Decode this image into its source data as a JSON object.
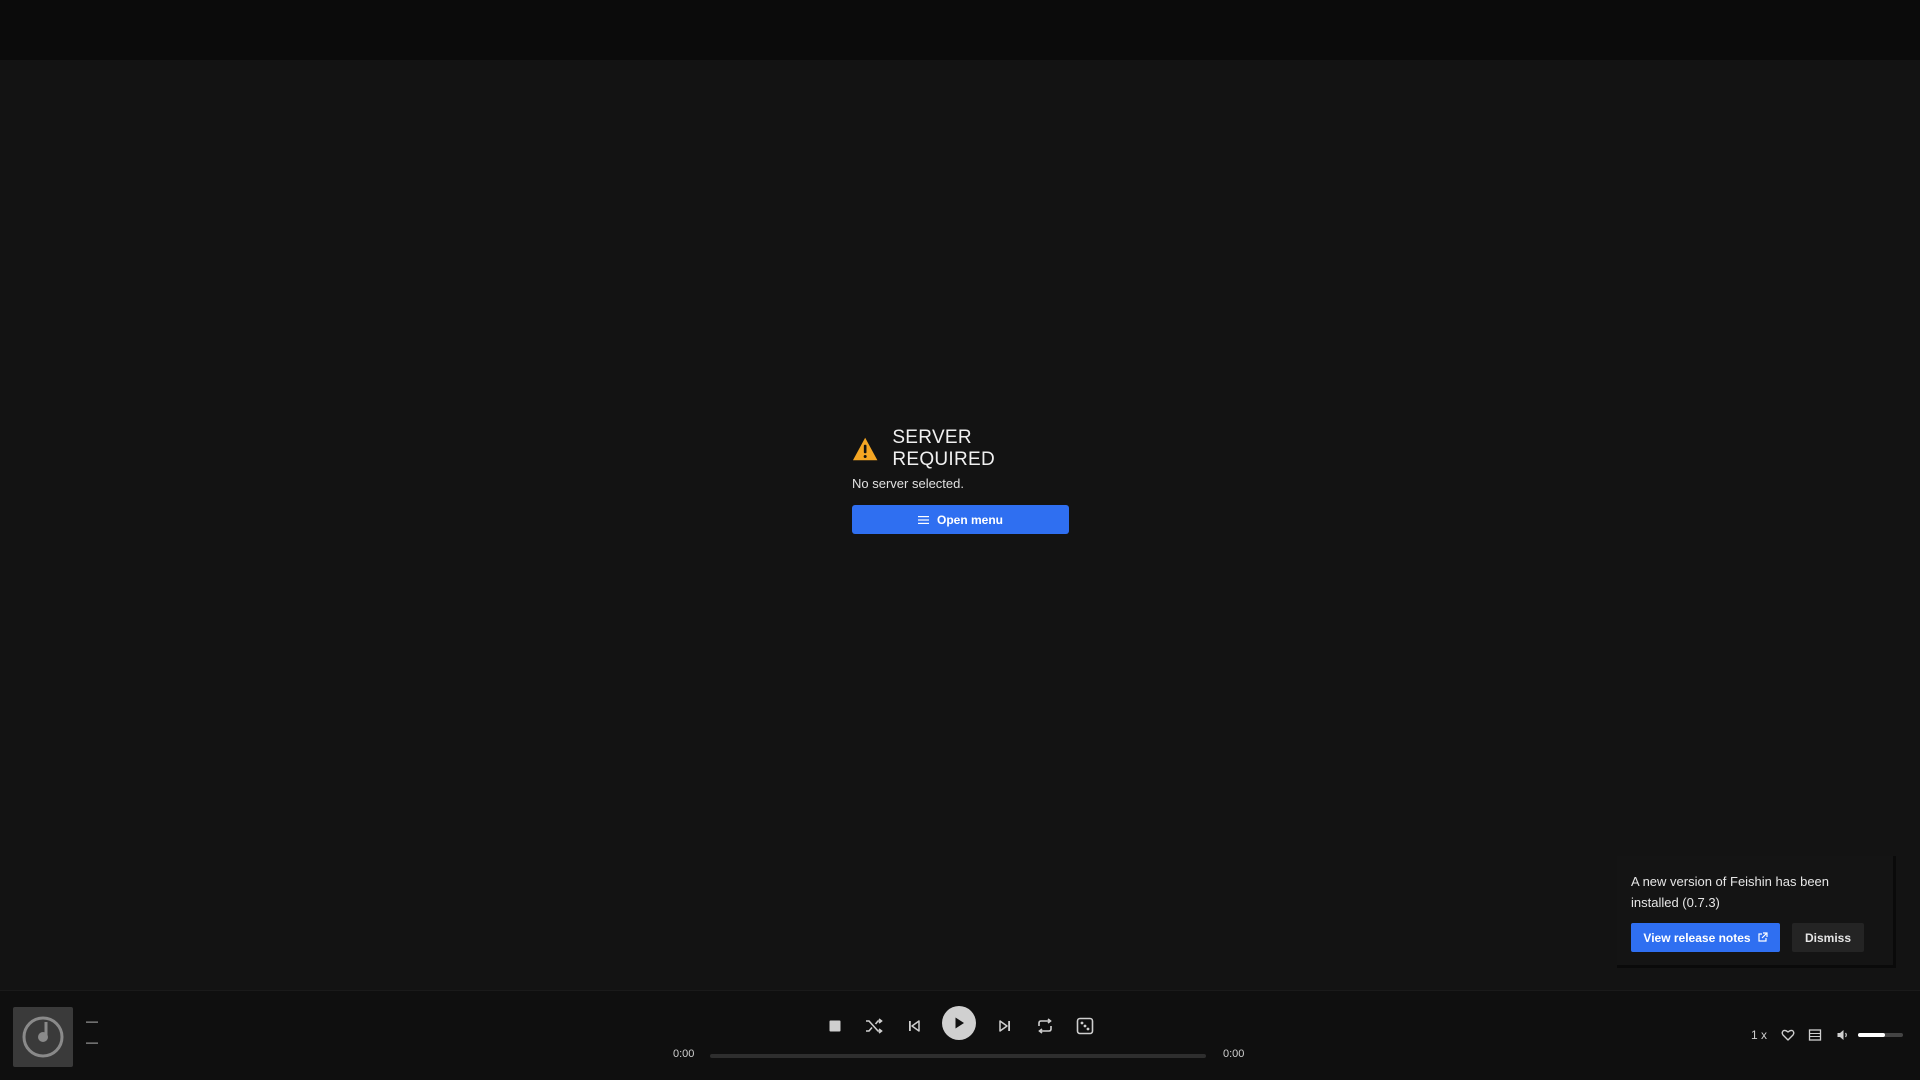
{
  "error": {
    "title": "SERVER REQUIRED",
    "message": "No server selected.",
    "button_label": "Open menu",
    "warning_color": "#f5a623"
  },
  "toast": {
    "message": "A new version of Feishin has been installed (0.7.3)",
    "primary_label": "View release notes",
    "dismiss_label": "Dismiss"
  },
  "player": {
    "track_title": "—",
    "track_artist": "—",
    "time_elapsed": "0:00",
    "time_total": "0:00",
    "progress_fraction": 0,
    "speed": "1 x",
    "volume_fraction": 0.6,
    "controls": [
      "stop-icon",
      "shuffle-icon",
      "previous-icon",
      "play-icon",
      "next-icon",
      "repeat-icon",
      "random-icon"
    ],
    "right_controls": [
      "heart-icon",
      "queue-icon",
      "volume-icon"
    ]
  },
  "colors": {
    "accent": "#2f6ff1",
    "background": "#131313"
  }
}
